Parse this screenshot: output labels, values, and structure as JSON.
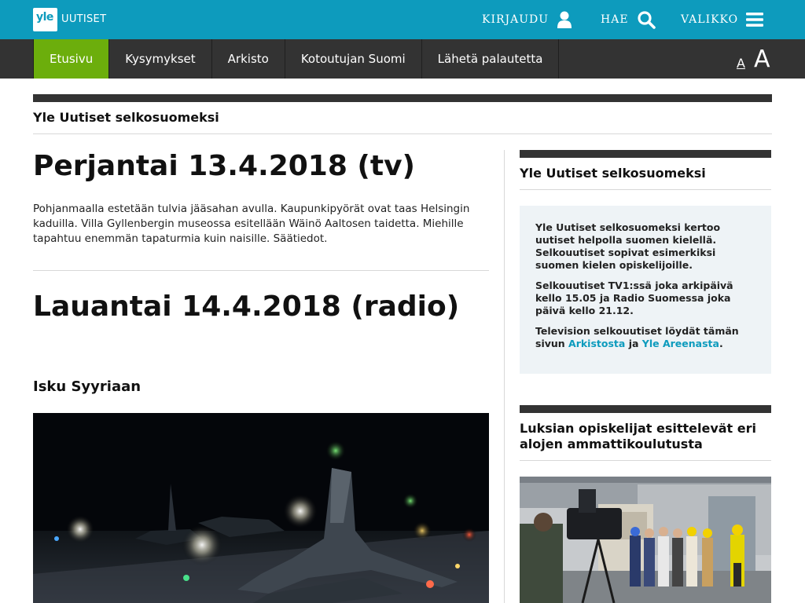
{
  "header": {
    "logo_mark": "yle",
    "logo_text": "UUTISET",
    "login_label": "KIRJAUDU",
    "login_icon": "user-icon",
    "search_label": "HAE",
    "search_icon": "search-icon",
    "menu_label": "VALIKKO",
    "menu_icon": "hamburger-icon",
    "brand_color": "#0d9bbd"
  },
  "nav": {
    "items": [
      {
        "label": "Etusivu",
        "active": true
      },
      {
        "label": "Kysymykset",
        "active": false
      },
      {
        "label": "Arkisto",
        "active": false
      },
      {
        "label": "Kotoutujan Suomi",
        "active": false
      },
      {
        "label": "Lähetä palautetta",
        "active": false
      }
    ],
    "font_small": "A",
    "font_large": "A",
    "active_color": "#6cae0c"
  },
  "section": {
    "title": "Yle Uutiset selkosuomeksi"
  },
  "main": {
    "friday_title": "Perjantai 13.4.2018 (tv)",
    "friday_desc": "Pohjanmaalla estetään tulvia jääsahan avulla. Kaupunkipyörät ovat taas Helsingin kaduilla. Villa Gyllenbergin museossa esitellään Wäinö Aaltosen taidetta. Miehille tapahtuu enemmän tapaturmia kuin naisille. Säätiedot.",
    "saturday_title": "Lauantai 14.4.2018 (radio)",
    "story_heading": "Isku Syyriaan"
  },
  "sidebar": {
    "title": "Yle Uutiset selkosuomeksi",
    "p1": "Yle Uutiset selkosuomeksi kertoo uutiset helpolla suomen kielellä. Selkouutiset sopivat esimerkiksi suomen kielen opiskelijoille.",
    "p2": "Selkouutiset TV1:ssä joka arkipäivä kello 15.05 ja Radio Suomessa joka päivä kello 21.12.",
    "p3_start": "Television selkouutiset löydät tämän sivun",
    "link_archive": "Arkistosta",
    "p3_and": "ja",
    "link_areena": "Yle Areenasta",
    "p3_end": ".",
    "link_color": "#0d9bbd",
    "article_title": "Luksian opiskelijat esittelevät eri alojen ammattikoulutusta"
  }
}
